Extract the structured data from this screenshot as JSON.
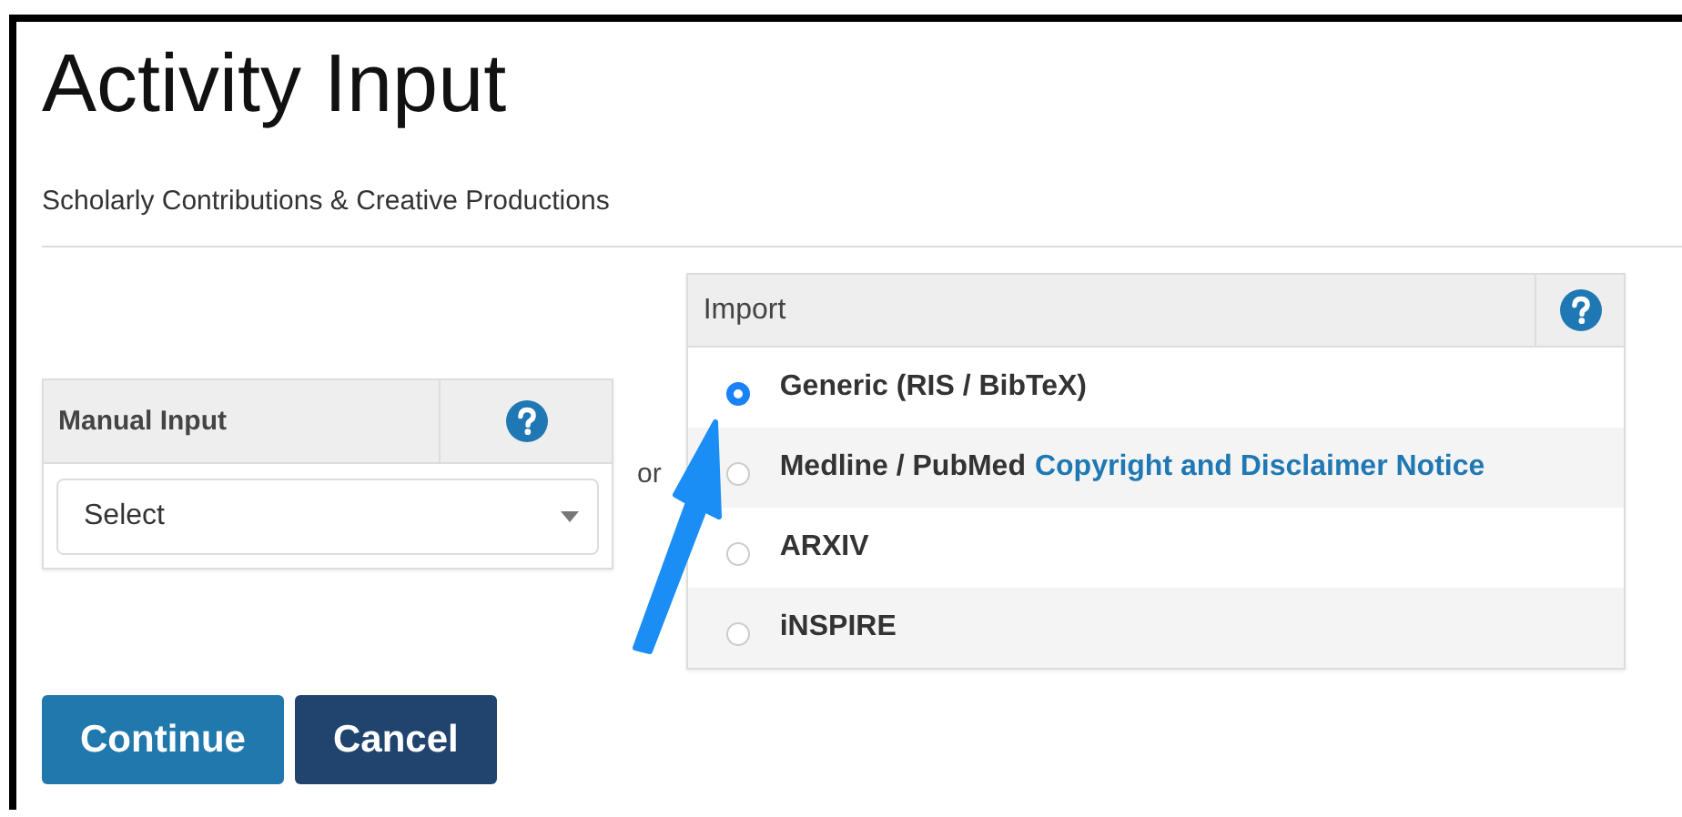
{
  "page": {
    "title": "Activity Input",
    "subtitle": "Scholarly Contributions & Creative Productions"
  },
  "manual_input": {
    "title": "Manual Input",
    "select": {
      "value": "Select"
    }
  },
  "separator": "or",
  "import": {
    "title": "Import",
    "options": [
      {
        "label": "Generic (RIS / BibTeX)",
        "selected": true
      },
      {
        "label": "Medline / PubMed",
        "link": "Copyright and Disclaimer Notice",
        "selected": false
      },
      {
        "label": "ARXIV",
        "selected": false
      },
      {
        "label": "iNSPIRE",
        "selected": false
      }
    ]
  },
  "buttons": [
    {
      "label": "Continue",
      "kind": "primary"
    },
    {
      "label": "Cancel",
      "kind": "secondary"
    }
  ]
}
